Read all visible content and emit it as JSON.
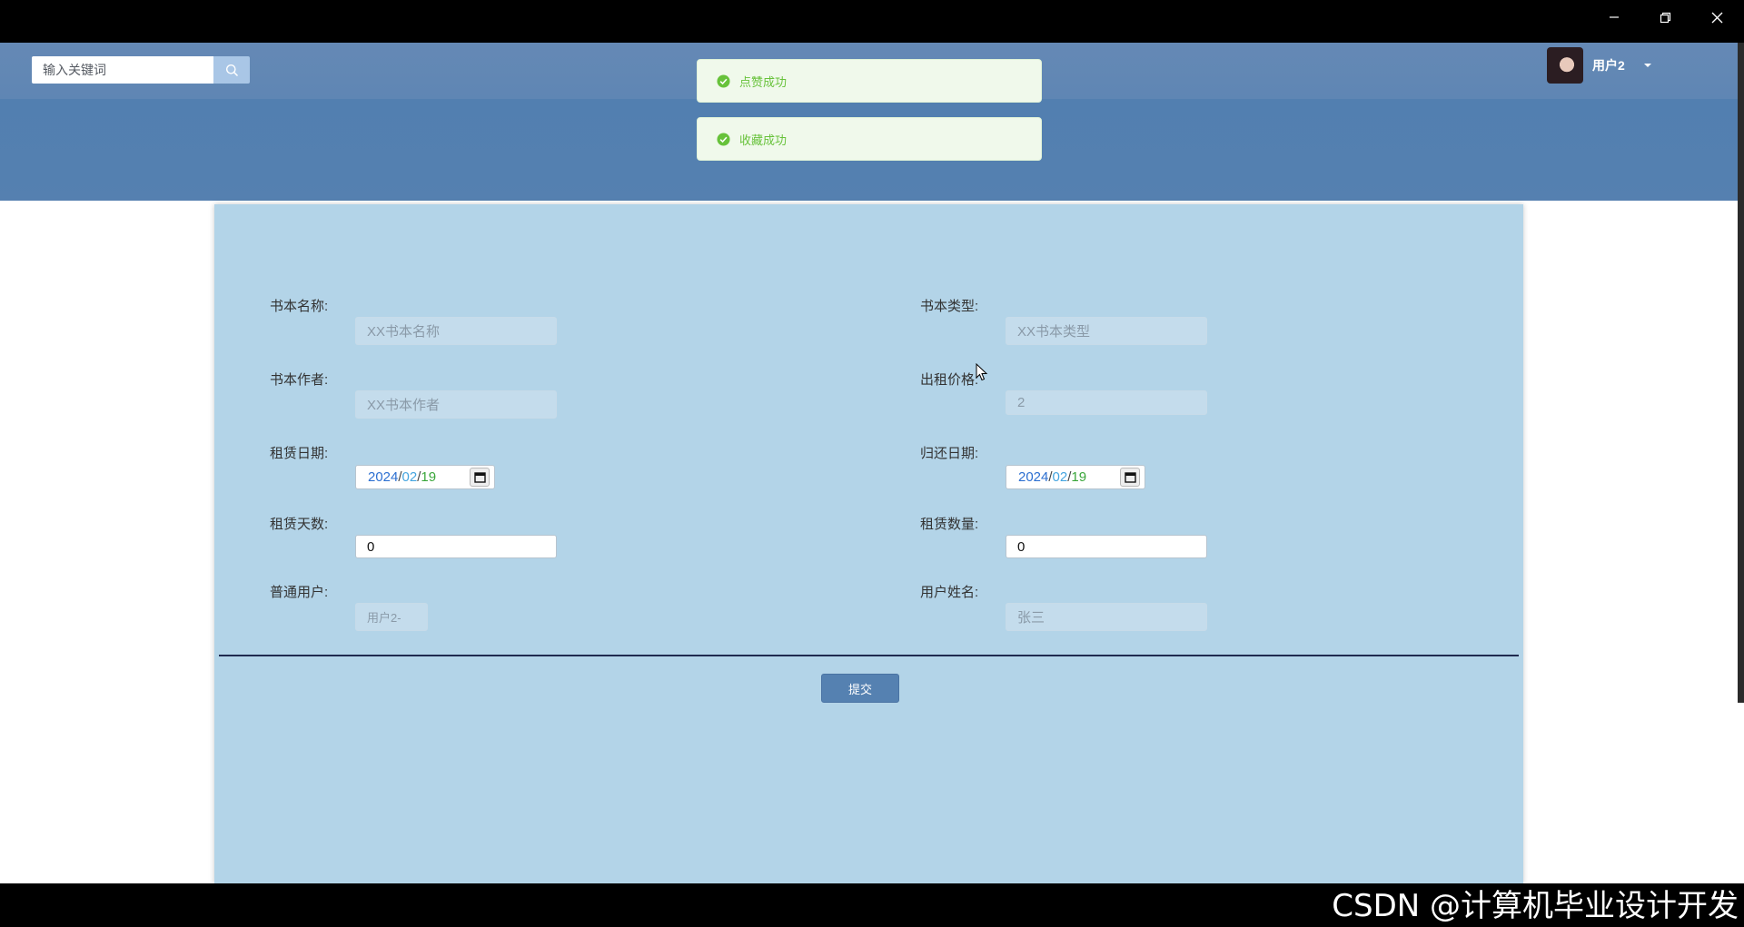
{
  "window": {
    "controls": [
      "minimize-icon",
      "restore-icon",
      "close-icon"
    ]
  },
  "header": {
    "search": {
      "placeholder": "输入关键词",
      "value": ""
    },
    "user": {
      "name": "用户2"
    }
  },
  "toasts": [
    {
      "text": "点赞成功",
      "type": "success"
    },
    {
      "text": "收藏成功",
      "type": "success"
    }
  ],
  "form": {
    "book_name": {
      "label": "书本名称:",
      "value": "XX书本名称"
    },
    "book_type": {
      "label": "书本类型:",
      "value": "XX书本类型"
    },
    "book_author": {
      "label": "书本作者:",
      "value": "XX书本作者"
    },
    "rent_price": {
      "label": "出租价格:",
      "value": "2"
    },
    "rent_date": {
      "label": "租赁日期:",
      "year": "2024",
      "month": "02",
      "day": "19"
    },
    "return_date": {
      "label": "归还日期:",
      "year": "2024",
      "month": "02",
      "day": "19"
    },
    "rent_days": {
      "label": "租赁天数:",
      "value": "0"
    },
    "rent_quantity": {
      "label": "租赁数量:",
      "value": "0"
    },
    "user_account": {
      "label": "普通用户:",
      "value": "用户2-"
    },
    "user_name": {
      "label": "用户姓名:",
      "value": "张三"
    },
    "submit_label": "提交"
  },
  "watermark": "CSDN @计算机毕业设计开发",
  "colors": {
    "header": "#5580b0",
    "card": "#b3d4e8",
    "toast_bg": "#f0f9eb",
    "toast_text": "#67c23a",
    "button": "#5581b1"
  }
}
